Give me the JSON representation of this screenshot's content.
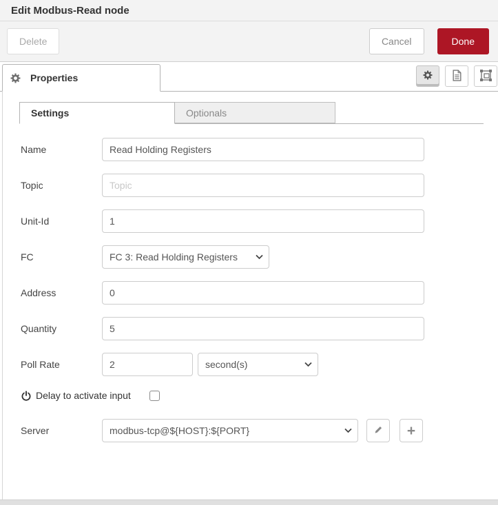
{
  "window": {
    "title": "Edit Modbus-Read node"
  },
  "actions": {
    "delete": "Delete",
    "cancel": "Cancel",
    "done": "Done"
  },
  "tray": {
    "properties_label": "Properties"
  },
  "tabs": [
    {
      "label": "Settings",
      "active": true
    },
    {
      "label": "Optionals",
      "active": false
    }
  ],
  "form": {
    "name": {
      "label": "Name",
      "value": "Read Holding Registers"
    },
    "topic": {
      "label": "Topic",
      "placeholder": "Topic"
    },
    "unit_id": {
      "label": "Unit-Id",
      "value": "1"
    },
    "fc": {
      "label": "FC",
      "value": "FC 3: Read Holding Registers"
    },
    "address": {
      "label": "Address",
      "value": "0"
    },
    "quantity": {
      "label": "Quantity",
      "value": "5"
    },
    "poll_rate": {
      "label": "Poll Rate",
      "value": "2",
      "unit": "second(s)"
    },
    "delay": {
      "label": "Delay to activate input",
      "checked": false
    },
    "server": {
      "label": "Server",
      "value": "modbus-tcp@${HOST}:${PORT}"
    }
  },
  "icons": {
    "plus": "+",
    "names": [
      "gear-icon",
      "document-icon",
      "object-group-icon",
      "power-icon",
      "pencil-icon",
      "plus-icon",
      "chevron-down-icon"
    ]
  },
  "colors": {
    "accent": "#AD1625",
    "header_bg": "#f3f3f3"
  }
}
